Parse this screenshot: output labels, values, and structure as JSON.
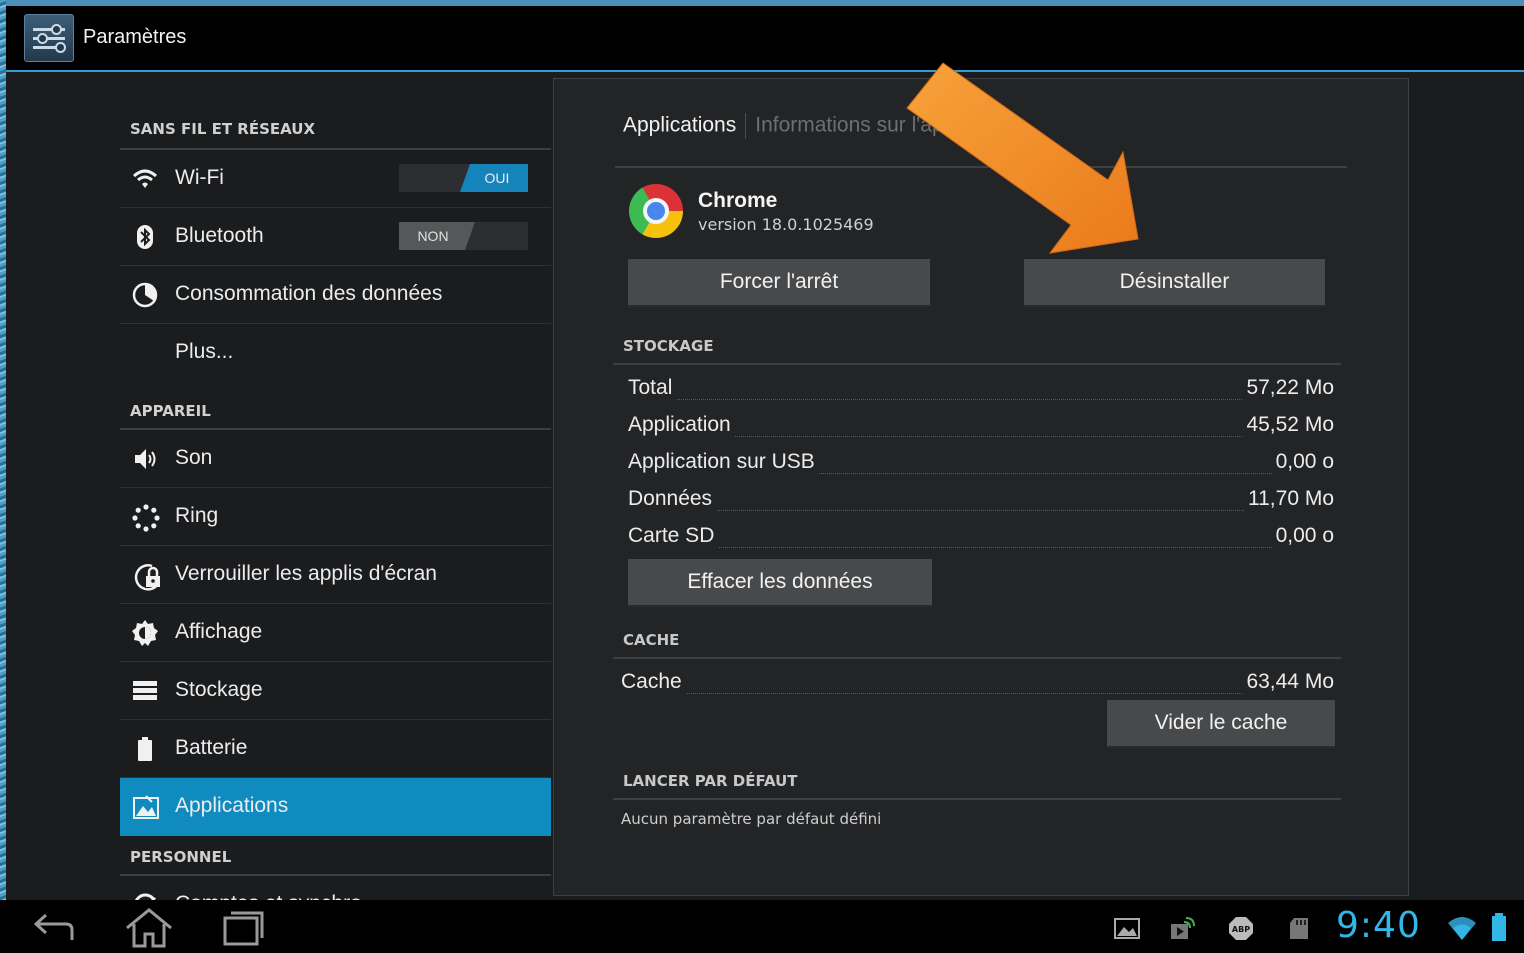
{
  "app_bar": {
    "title": "Paramètres"
  },
  "sidebar": {
    "sections": [
      {
        "title": "SANS FIL ET RÉSEAUX"
      },
      {
        "title": "APPAREIL"
      },
      {
        "title": "PERSONNEL"
      }
    ],
    "items": [
      {
        "label": "Wi-Fi",
        "icon": "wifi-icon",
        "toggle": "OUI"
      },
      {
        "label": "Bluetooth",
        "icon": "bluetooth-icon",
        "toggle": "NON"
      },
      {
        "label": "Consommation des données",
        "icon": "data-usage-icon"
      },
      {
        "label": "Plus..."
      },
      {
        "label": "Son",
        "icon": "speaker-icon"
      },
      {
        "label": "Ring",
        "icon": "ring-icon"
      },
      {
        "label": "Verrouiller les applis d'écran",
        "icon": "lock-icon"
      },
      {
        "label": "Affichage",
        "icon": "brightness-icon"
      },
      {
        "label": "Stockage",
        "icon": "storage-icon"
      },
      {
        "label": "Batterie",
        "icon": "battery-icon"
      },
      {
        "label": "Applications",
        "icon": "apps-icon",
        "active": true
      },
      {
        "label": "Comptes et synchro",
        "icon": "sync-icon"
      }
    ]
  },
  "detail": {
    "breadcrumb": {
      "current": "Applications",
      "next": "Informations sur l'application"
    },
    "app": {
      "name": "Chrome",
      "version": "version 18.0.1025469"
    },
    "buttons": {
      "force_stop": "Forcer l'arrêt",
      "uninstall": "Désinstaller",
      "clear_data": "Effacer les données",
      "clear_cache": "Vider le cache"
    },
    "storage": {
      "title": "STOCKAGE",
      "rows": [
        {
          "label": "Total",
          "value": "57,22 Mo"
        },
        {
          "label": "Application",
          "value": "45,52 Mo"
        },
        {
          "label": "Application sur USB",
          "value": "0,00 o"
        },
        {
          "label": "Données",
          "value": "11,70 Mo"
        },
        {
          "label": "Carte SD",
          "value": "0,00 o"
        }
      ]
    },
    "cache": {
      "title": "CACHE",
      "label": "Cache",
      "value": "63,44 Mo"
    },
    "defaults": {
      "title": "LANCER PAR DÉFAUT",
      "text": "Aucun paramètre par défaut défini"
    }
  },
  "annotation": {
    "color": "#f28a25"
  },
  "navbar": {
    "clock": "9:40"
  },
  "colors": {
    "accent": "#33b5e5",
    "active_item": "#0f8bc0"
  }
}
